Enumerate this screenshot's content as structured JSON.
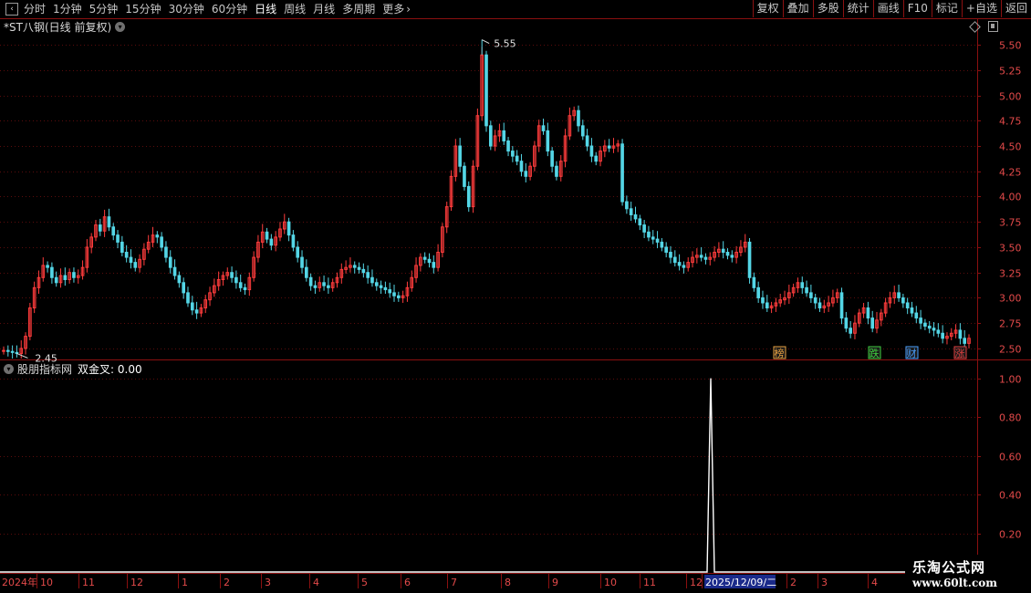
{
  "toolbar": {
    "periods": [
      {
        "label": "分时",
        "active": false
      },
      {
        "label": "1分钟",
        "active": false
      },
      {
        "label": "5分钟",
        "active": false
      },
      {
        "label": "15分钟",
        "active": false
      },
      {
        "label": "30分钟",
        "active": false
      },
      {
        "label": "60分钟",
        "active": false
      },
      {
        "label": "日线",
        "active": true
      },
      {
        "label": "周线",
        "active": false
      },
      {
        "label": "月线",
        "active": false
      },
      {
        "label": "多周期",
        "active": false
      },
      {
        "label": "更多",
        "active": false
      }
    ],
    "buttons": [
      "复权",
      "叠加",
      "多股",
      "统计",
      "画线",
      "F10",
      "标记",
      "+自选",
      "返回"
    ],
    "more_arrow": "›"
  },
  "stock": {
    "title": "*ST八钢(日线 前复权)",
    "high_label": "5.55",
    "low_label": "2.45"
  },
  "indicator": {
    "name": "股朋指标网",
    "formula": "双金叉: 0.00"
  },
  "markers": [
    {
      "text": "榜",
      "color": "#e8a040"
    },
    {
      "text": "跌",
      "color": "#40d040"
    },
    {
      "text": "财",
      "color": "#4aa0ff"
    },
    {
      "text": "涨",
      "color": "#e04040"
    }
  ],
  "watermark": {
    "title": "乐淘公式网",
    "url": "www.60lt.com"
  },
  "colors": {
    "up": "#ff3c3c",
    "down": "#54d6e6",
    "axis": "#8b1010",
    "grid": "#5a0c0c",
    "indicator_line": "#ffffff"
  },
  "chart_data": [
    {
      "type": "candlestick",
      "title": "*ST八钢(日线 前复权)",
      "ylim": [
        2.4,
        5.6
      ],
      "y_ticks": [
        2.5,
        2.75,
        3.0,
        3.25,
        3.5,
        3.75,
        4.0,
        4.25,
        4.5,
        4.75,
        5.0,
        5.25,
        5.5
      ],
      "annotated_high": 5.55,
      "annotated_low": 2.45,
      "x_ticks": [
        "2024年",
        "10",
        "11",
        "12",
        "1",
        "2",
        "3",
        "4",
        "5",
        "6",
        "7",
        "8",
        "9",
        "10",
        "11",
        "12",
        "2025/12/09/二",
        "2",
        "3",
        "4"
      ],
      "close": [
        2.48,
        2.47,
        2.46,
        2.45,
        2.5,
        2.62,
        2.9,
        3.1,
        3.2,
        3.32,
        3.3,
        3.2,
        3.15,
        3.22,
        3.18,
        3.25,
        3.2,
        3.22,
        3.3,
        3.5,
        3.6,
        3.72,
        3.66,
        3.8,
        3.7,
        3.62,
        3.55,
        3.45,
        3.4,
        3.35,
        3.3,
        3.38,
        3.48,
        3.55,
        3.62,
        3.6,
        3.5,
        3.4,
        3.3,
        3.22,
        3.15,
        3.05,
        2.95,
        2.88,
        2.85,
        2.9,
        2.98,
        3.05,
        3.12,
        3.18,
        3.22,
        3.25,
        3.2,
        3.15,
        3.1,
        3.08,
        3.2,
        3.4,
        3.55,
        3.65,
        3.58,
        3.52,
        3.6,
        3.68,
        3.75,
        3.62,
        3.5,
        3.4,
        3.3,
        3.2,
        3.12,
        3.1,
        3.15,
        3.12,
        3.1,
        3.15,
        3.2,
        3.28,
        3.3,
        3.32,
        3.3,
        3.28,
        3.25,
        3.2,
        3.15,
        3.12,
        3.1,
        3.08,
        3.05,
        3.02,
        3.0,
        3.02,
        3.1,
        3.2,
        3.32,
        3.4,
        3.38,
        3.35,
        3.3,
        3.45,
        3.7,
        3.9,
        4.2,
        4.5,
        4.3,
        4.1,
        3.9,
        4.3,
        4.8,
        5.4,
        4.7,
        4.5,
        4.6,
        4.65,
        4.55,
        4.45,
        4.4,
        4.35,
        4.25,
        4.2,
        4.3,
        4.5,
        4.7,
        4.65,
        4.45,
        4.3,
        4.2,
        4.35,
        4.6,
        4.8,
        4.85,
        4.7,
        4.6,
        4.5,
        4.4,
        4.35,
        4.45,
        4.5,
        4.48,
        4.5,
        4.52,
        3.95,
        3.88,
        3.82,
        3.78,
        3.72,
        3.65,
        3.6,
        3.58,
        3.55,
        3.5,
        3.45,
        3.4,
        3.35,
        3.32,
        3.3,
        3.35,
        3.4,
        3.42,
        3.4,
        3.38,
        3.4,
        3.45,
        3.48,
        3.45,
        3.42,
        3.4,
        3.45,
        3.5,
        3.55,
        3.2,
        3.1,
        3.0,
        2.95,
        2.9,
        2.92,
        2.95,
        2.98,
        3.0,
        3.05,
        3.1,
        3.15,
        3.1,
        3.05,
        3.0,
        2.95,
        2.9,
        2.92,
        2.95,
        3.0,
        3.05,
        2.8,
        2.7,
        2.65,
        2.75,
        2.85,
        2.9,
        2.8,
        2.7,
        2.78,
        2.85,
        2.95,
        3.0,
        3.05,
        3.0,
        2.95,
        2.9,
        2.85,
        2.8,
        2.75,
        2.72,
        2.7,
        2.68,
        2.65,
        2.6,
        2.62,
        2.65,
        2.68,
        2.6,
        2.55,
        2.6
      ]
    },
    {
      "type": "line",
      "title": "股朋指标网",
      "series_label": "双金叉",
      "current_value": 0.0,
      "ylim": [
        0,
        1.05
      ],
      "y_ticks": [
        0.2,
        0.4,
        0.6,
        0.8,
        1.0
      ],
      "signal_points": [
        {
          "x": "2025/12/09/二",
          "value": 1.0
        }
      ]
    }
  ]
}
